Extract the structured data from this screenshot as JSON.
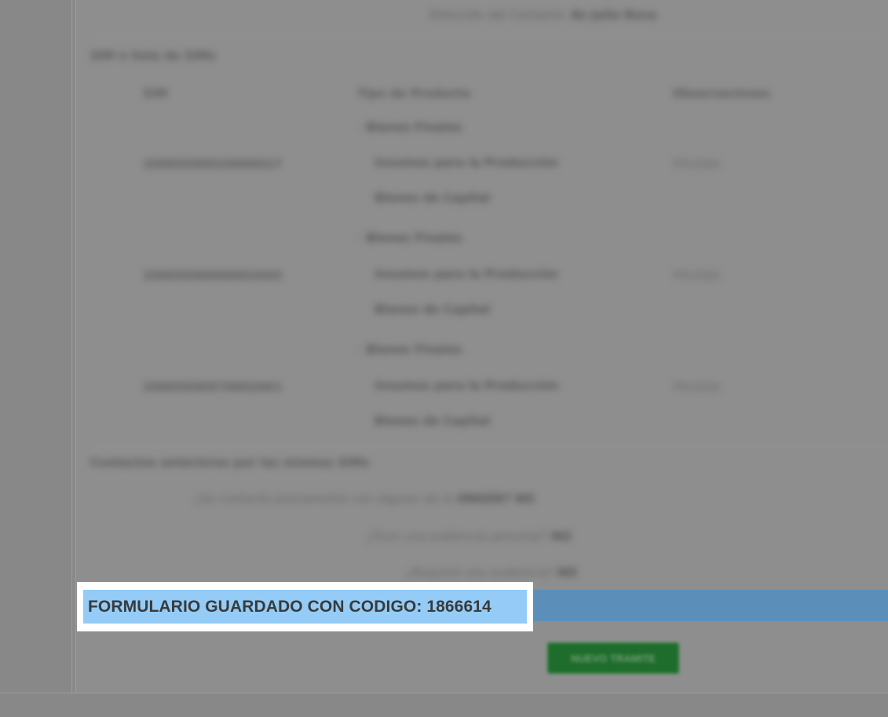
{
  "form": {
    "contact_address": {
      "label": "Dirección del Contacto:",
      "value": "Av Julio Roca"
    },
    "sim_section": {
      "title": "SIM o lista de SIMs",
      "headers": {
        "sim": "SIM",
        "product_type": "Tipo de Producto",
        "observations": "Observaciones"
      },
      "rows": [
        {
          "sim": "20005090020000027",
          "products": [
            "Bienes Finales",
            "Insumos para la Producción",
            "Bienes de Capital"
          ],
          "observations": "PRUEBA"
        },
        {
          "sim": "20005090000002045",
          "products": [
            "Bienes Finales",
            "Insumos para la Producción",
            "Bienes de Capital"
          ],
          "observations": "PRUEBA"
        },
        {
          "sim": "20005090970002061",
          "products": [
            "Bienes Finales",
            "Insumos para la Producción",
            "Bienes de Capital"
          ],
          "observations": "PRUEBA"
        }
      ]
    },
    "previous_contacts": {
      "title": "Contactos anteriores por las mismas SIMs",
      "questions": [
        {
          "label": "¿Se contactó previamente con alguien de la",
          "strong": "ONGDE?",
          "answer": "NO"
        },
        {
          "label": "¿Tuvo una audiencia personal?",
          "answer": "NO"
        },
        {
          "label": "¿Requirió una audiencia?",
          "answer": "NO"
        }
      ]
    }
  },
  "confirmation": {
    "text": "FORMULARIO GUARDADO CON CODIGO: 1866614"
  },
  "actions": {
    "primary_label": "NUEVO TRAMITE"
  },
  "colors": {
    "confirmation_highlight": "#94ccf7",
    "confirmation_strip": "#5b8fba",
    "primary_button": "#1f6d2c"
  }
}
